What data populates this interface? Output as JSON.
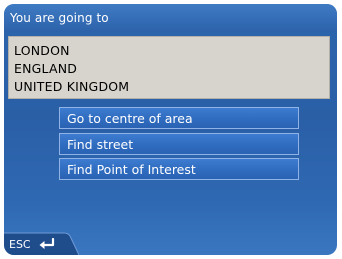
{
  "header": {
    "title": "You are going to"
  },
  "destination": {
    "lines": [
      "LONDON",
      "ENGLAND",
      "UNITED KINGDOM"
    ]
  },
  "options": [
    {
      "label": "Go to centre of area"
    },
    {
      "label": "Find street"
    },
    {
      "label": "Find Point of Interest"
    }
  ],
  "footer": {
    "esc_label": "ESC",
    "esc_icon": "enter-arrow-icon"
  }
}
